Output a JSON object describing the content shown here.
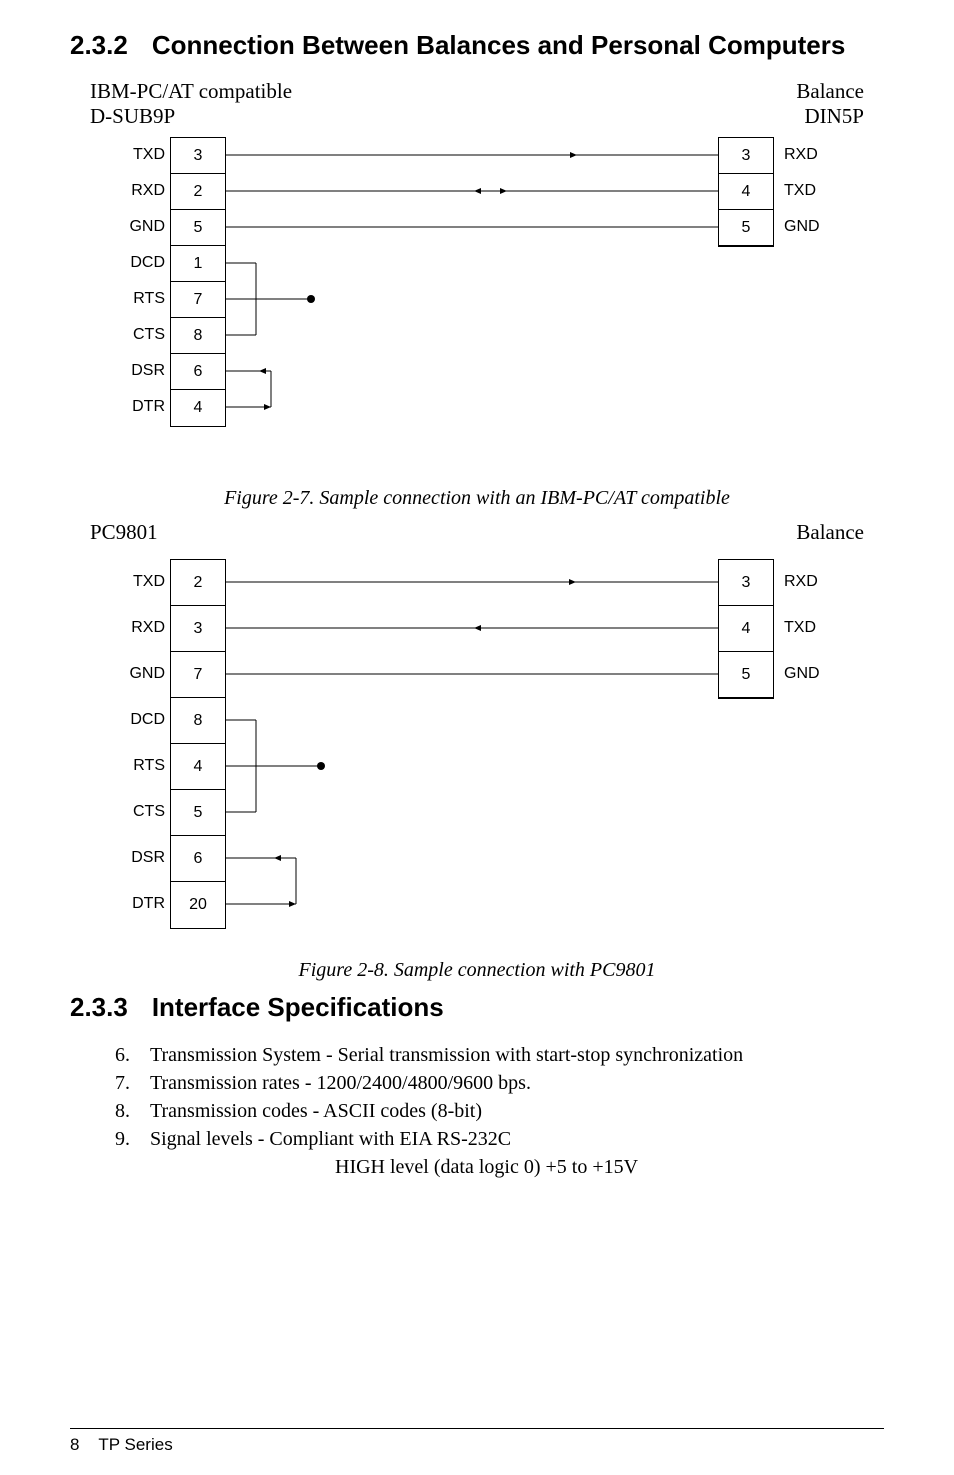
{
  "sec232": {
    "num": "2.3.2",
    "title": "Connection Between Balances and Personal Computers"
  },
  "fig27": {
    "topLeft1": "IBM-PC/AT compatible",
    "topLeft2": "D-SUB9P",
    "topRight1": "Balance",
    "topRight2": "DIN5P",
    "left": [
      {
        "lbl": "TXD",
        "pin": "3"
      },
      {
        "lbl": "RXD",
        "pin": "2"
      },
      {
        "lbl": "GND",
        "pin": "5"
      },
      {
        "lbl": "DCD",
        "pin": "1"
      },
      {
        "lbl": "RTS",
        "pin": "7"
      },
      {
        "lbl": "CTS",
        "pin": "8"
      },
      {
        "lbl": "DSR",
        "pin": "6"
      },
      {
        "lbl": "DTR",
        "pin": "4"
      }
    ],
    "right": [
      {
        "lbl": "RXD",
        "pin": "3"
      },
      {
        "lbl": "TXD",
        "pin": "4"
      },
      {
        "lbl": "GND",
        "pin": "5"
      }
    ],
    "caption": "Figure 2-7. Sample connection with an IBM-PC/AT compatible"
  },
  "fig28": {
    "topLeft": "PC9801",
    "topRight": "Balance",
    "left": [
      {
        "lbl": "TXD",
        "pin": "2"
      },
      {
        "lbl": "RXD",
        "pin": "3"
      },
      {
        "lbl": "GND",
        "pin": "7"
      },
      {
        "lbl": "DCD",
        "pin": "8"
      },
      {
        "lbl": "RTS",
        "pin": "4"
      },
      {
        "lbl": "CTS",
        "pin": "5"
      },
      {
        "lbl": "DSR",
        "pin": "6"
      },
      {
        "lbl": "DTR",
        "pin": "20"
      }
    ],
    "right": [
      {
        "lbl": "RXD",
        "pin": "3"
      },
      {
        "lbl": "TXD",
        "pin": "4"
      },
      {
        "lbl": "GND",
        "pin": "5"
      }
    ],
    "caption": "Figure 2-8. Sample connection with PC9801"
  },
  "sec233": {
    "num": "2.3.3",
    "title": "Interface Specifications"
  },
  "specs": [
    {
      "n": "6.",
      "t": "Transmission System - Serial transmission with start-stop synchronization"
    },
    {
      "n": "7.",
      "t": "Transmission rates - 1200/2400/4800/9600 bps."
    },
    {
      "n": "8.",
      "t": "Transmission codes - ASCII codes (8-bit)"
    },
    {
      "n": "9.",
      "t": "Signal levels -  Compliant with EIA RS-232C"
    }
  ],
  "specExtra": "HIGH level (data logic 0) +5 to +15V",
  "footer": {
    "page": "8",
    "series": "TP Series"
  }
}
